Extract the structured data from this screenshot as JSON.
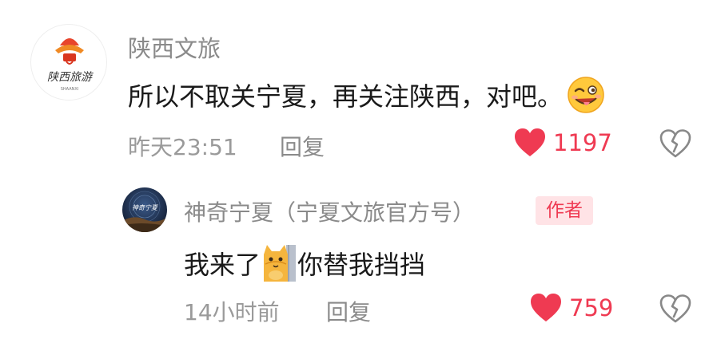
{
  "colors": {
    "accent": "#ef3a52",
    "muted": "#9a9a9a",
    "text": "#1a1a1a",
    "badge_bg": "#ffe3e6"
  },
  "comments": [
    {
      "avatar_logo_text": "陕西旅游",
      "avatar_logo_subtext": "SHAANXI",
      "username": "陕西文旅",
      "text": "所以不取关宁夏，再关注陕西，对吧。",
      "emoji_icon": "wink-tongue-emoji-icon",
      "time": "昨天23:51",
      "reply_label": "回复",
      "like_icon": "heart-icon",
      "likes": "1197",
      "dislike_icon": "broken-heart-icon"
    },
    {
      "username": "神奇宁夏（宁夏文旅官方号）",
      "badge": "作者",
      "text_before": "我来了",
      "sticker_icon": "cat-peeking-sticker-icon",
      "text_after": "你替我挡挡",
      "time": "14小时前",
      "reply_label": "回复",
      "like_icon": "heart-icon",
      "likes": "759",
      "dislike_icon": "broken-heart-icon"
    }
  ]
}
